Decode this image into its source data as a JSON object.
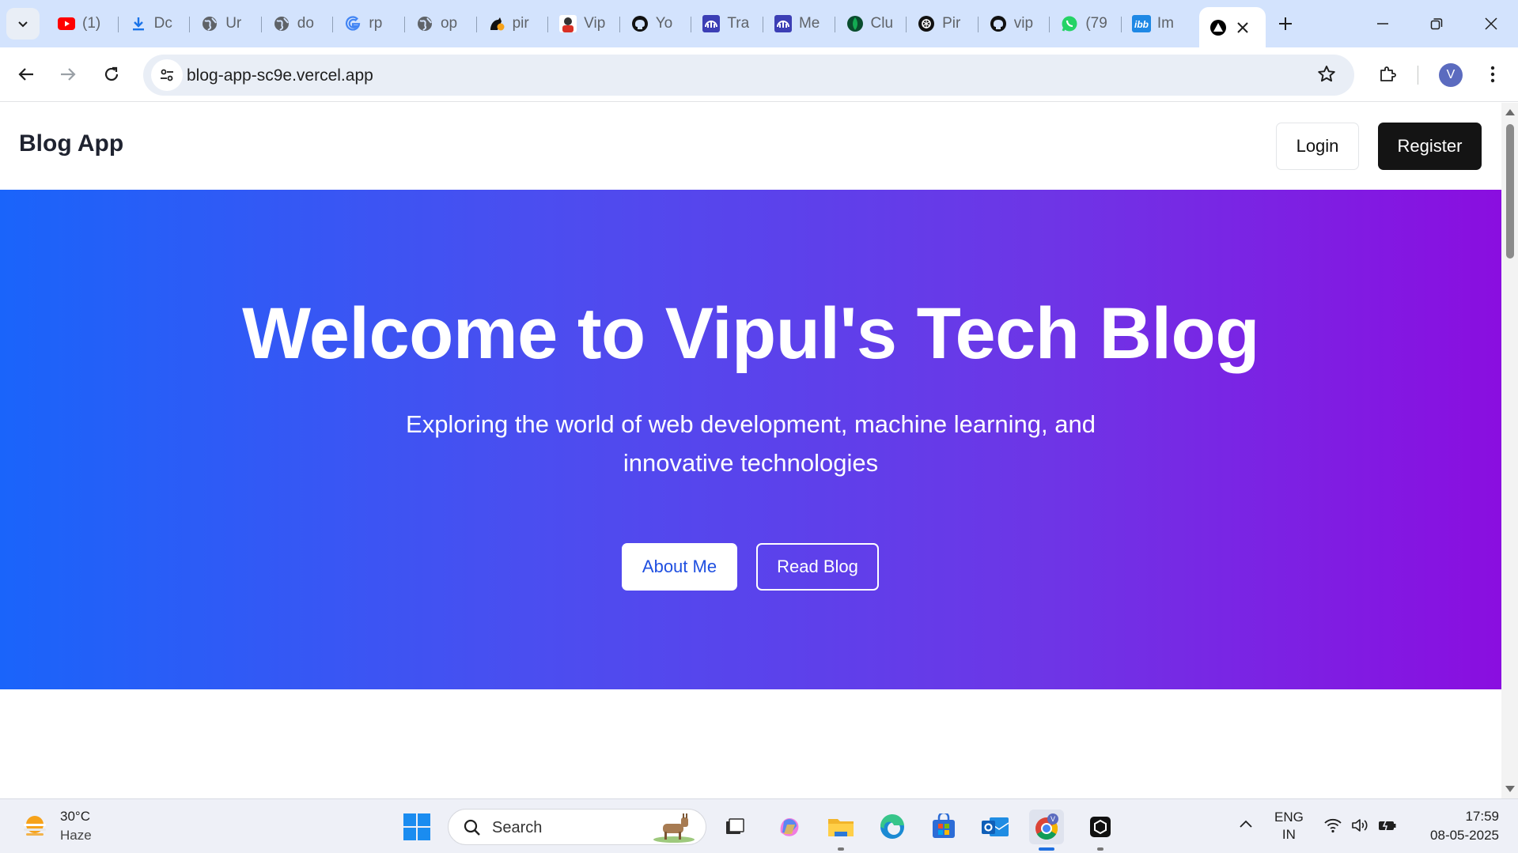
{
  "browser": {
    "tabs": [
      {
        "title": "(1)",
        "icon": "youtube-icon",
        "color": "#ff0000"
      },
      {
        "title": "Dc",
        "icon": "download-icon",
        "color": "#1a73e8"
      },
      {
        "title": "Ur",
        "icon": "globe-icon",
        "color": "#5f6368"
      },
      {
        "title": "do",
        "icon": "globe-icon",
        "color": "#5f6368"
      },
      {
        "title": "rp",
        "icon": "google-icon",
        "color": "#4285f4"
      },
      {
        "title": "op",
        "icon": "globe-icon",
        "color": "#5f6368"
      },
      {
        "title": "pir",
        "icon": "pirate-icon",
        "color": "#111111"
      },
      {
        "title": "Vip",
        "icon": "profile-photo-icon",
        "color": "#d93025"
      },
      {
        "title": "Yo",
        "icon": "github-icon",
        "color": "#111111"
      },
      {
        "title": "Tra",
        "icon": "dashboard-icon",
        "color": "#3c3fb5"
      },
      {
        "title": "Me",
        "icon": "dashboard-icon",
        "color": "#3c3fb5"
      },
      {
        "title": "Clu",
        "icon": "mongodb-icon",
        "color": "#0a4d2e"
      },
      {
        "title": "Pir",
        "icon": "openai-icon",
        "color": "#111111"
      },
      {
        "title": "vip",
        "icon": "github-icon",
        "color": "#111111"
      },
      {
        "title": "(79",
        "icon": "whatsapp-icon",
        "color": "#25d366"
      },
      {
        "title": "Im",
        "icon": "imgbb-icon",
        "color": "#1e88e5"
      }
    ],
    "active_tab_icon": "vercel-icon",
    "address": "blog-app-sc9e.vercel.app",
    "profile_initial": "V"
  },
  "page": {
    "brand": "Blog App",
    "login_label": "Login",
    "register_label": "Register",
    "hero_title": "Welcome to Vipul's Tech Blog",
    "hero_subtitle_line1": "Exploring the world of web development, machine learning, and",
    "hero_subtitle_line2": "innovative technologies",
    "about_label": "About Me",
    "read_label": "Read Blog",
    "gradient_start": "#1a64fa",
    "gradient_end": "#8a0ee0"
  },
  "taskbar": {
    "temperature": "30°C",
    "condition": "Haze",
    "search_placeholder": "Search",
    "lang_line1": "ENG",
    "lang_line2": "IN",
    "time": "17:59",
    "date": "08-05-2025"
  }
}
